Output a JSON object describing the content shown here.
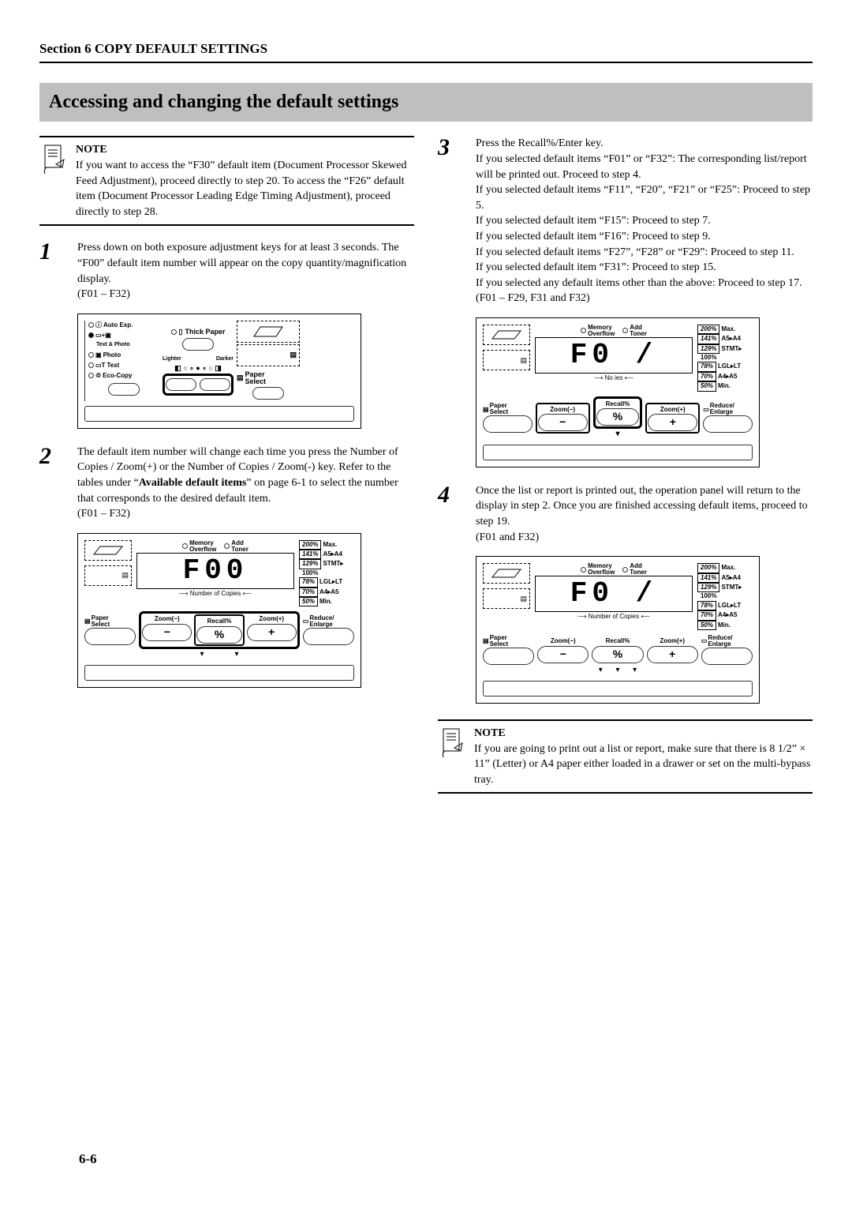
{
  "header": {
    "section": "Section 6  COPY DEFAULT SETTINGS"
  },
  "title": "Accessing and changing the default settings",
  "note1": {
    "label": "NOTE",
    "text": "If you want to access the “F30” default item (Document Processor Skewed Feed Adjustment), proceed directly to step 20. To access the “F26” default item (Document Processor Leading Edge Timing Adjustment), proceed directly to step 28."
  },
  "step1": {
    "num": "1",
    "text": "Press down on both exposure adjustment keys for at least 3 seconds. The “F00” default item number will appear on the copy quantity/magnification display.",
    "range": "(F01 – F32)"
  },
  "panel1": {
    "modes": {
      "auto": "Auto Exp.",
      "textphoto": "Text & Photo",
      "photo": "Photo",
      "text": "Text",
      "eco": "Eco-Copy"
    },
    "density": {
      "thick": "Thick Paper",
      "lighter": "Lighter",
      "darker": "Darker"
    },
    "paper": "Paper\nSelect"
  },
  "step2": {
    "num": "2",
    "text_a": "The default item number will change each time you press the Number of Copies / Zoom(+) or the Number of Copies / Zoom(-) key. Refer to the tables under “",
    "bold": "Available default items",
    "text_b": "” on page 6-1 to select the number that corresponds to the desired default item.",
    "range": "(F01 – F32)"
  },
  "panel2": {
    "mem": "Memory\nOverflow",
    "toner": "Add\nToner",
    "copies": "Number of Copies",
    "lcd": "F00",
    "btns": {
      "paper": "Paper\nSelect",
      "zoom_m": "Zoom(−)",
      "recall": "Recall%",
      "zoom_p": "Zoom(+)",
      "reduce": "Reduce/\nEnlarge"
    },
    "zoom": {
      "z200": "200%",
      "zmax": "Max.",
      "z141": "141%",
      "z141r": "A5▸A4",
      "z129": "129%",
      "z129r": "STMT▸",
      "z100": "100%",
      "z78": "78%",
      "z78r": "LGL▸LT",
      "z70": "70%",
      "z70r": "A4▸A5",
      "z50": "50%",
      "zmin": "Min."
    }
  },
  "step3": {
    "num": "3",
    "lines": [
      "Press the Recall%/Enter key.",
      "If you selected default items “F01” or “F32”: The corresponding list/report will be printed out. Proceed to step 4.",
      "If you selected default items “F11”, “F20”, “F21” or “F25”: Proceed to step 5.",
      "If you selected default item “F15”: Proceed to step 7.",
      "If you selected default item “F16”: Proceed to step 9.",
      "If you selected default items “F27”, “F28” or “F29”: Proceed to step 11.",
      "If you selected default item “F31”: Proceed to step 15.",
      "If you selected any default items other than the above: Proceed to step 17.",
      "(F01 – F29, F31 and F32)"
    ]
  },
  "panel3": {
    "lcd": "F0 /",
    "labels_caption": "No            ies"
  },
  "step4": {
    "num": "4",
    "text": "Once the list or report is printed out, the operation panel will return to the display in step 2. Once you are finished accessing default items, proceed to step 19.",
    "range": "(F01 and F32)"
  },
  "note2": {
    "label": "NOTE",
    "text": "If you are going to print out a list or report, make sure that there is 8 1/2” × 11” (Letter) or A4 paper either loaded in a drawer or set on the multi-bypass tray."
  },
  "pagefoot": "6-6"
}
